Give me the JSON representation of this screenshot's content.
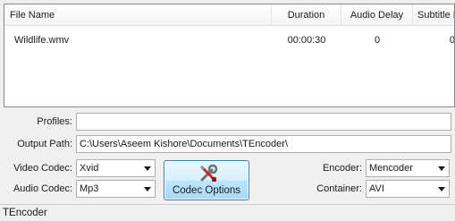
{
  "file_list": {
    "columns": {
      "file_name": "File Name",
      "duration": "Duration",
      "audio_delay": "Audio Delay",
      "subtitle": "Subtitle D"
    },
    "rows": [
      {
        "file_name": "Wildlife.wmv",
        "duration": "00:00:30",
        "audio_delay": "0",
        "subtitle": "0"
      }
    ]
  },
  "form": {
    "profiles_label": "Profiles:",
    "profiles_value": "",
    "output_path_label": "Output Path:",
    "output_path_value": "C:\\Users\\Aseem Kishore\\Documents\\TEncoder\\",
    "video_codec_label": "Video Codec:",
    "video_codec_value": "Xvid",
    "audio_codec_label": "Audio Codec:",
    "audio_codec_value": "Mp3",
    "codec_options_label": "Codec Options",
    "encoder_label": "Encoder:",
    "encoder_value": "Mencoder",
    "container_label": "Container:",
    "container_value": "AVI"
  },
  "status": {
    "text": "TEncoder"
  },
  "icons": {
    "codec_options": "tools-icon",
    "dropdown": "chevron-down-icon"
  },
  "colors": {
    "button_border": "#3c7fb1",
    "button_fill": "#bee6fd",
    "field_border": "#abadb3"
  }
}
